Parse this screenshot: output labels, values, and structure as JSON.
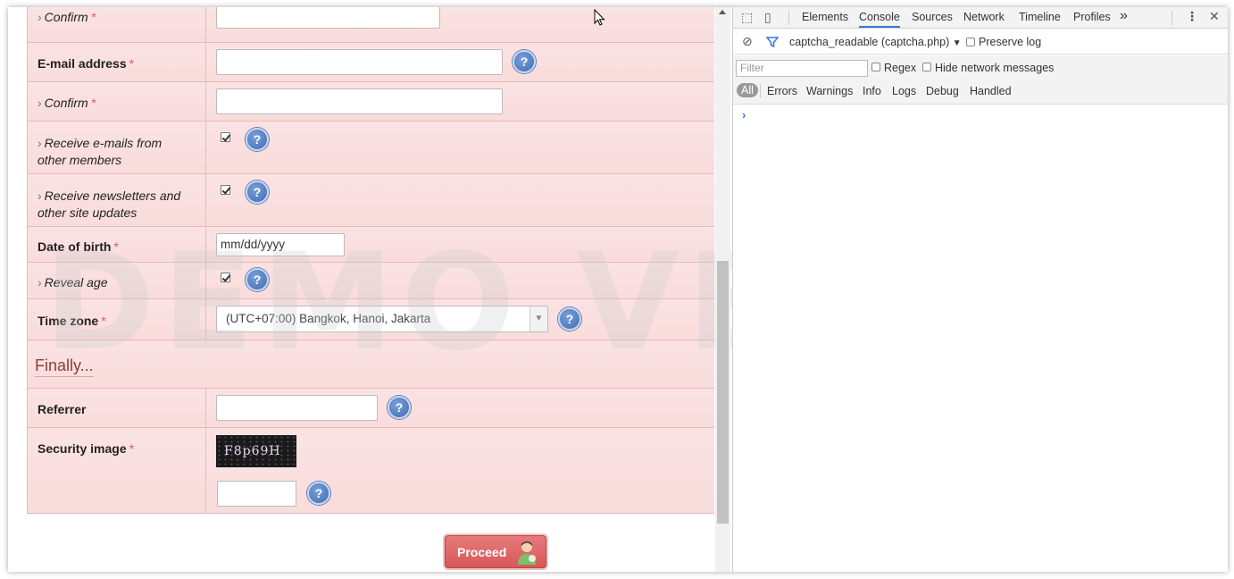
{
  "form": {
    "confirm_label_1": "Confirm",
    "email_label": "E-mail address",
    "confirm_label_2": "Confirm",
    "receive_emails_line1": "Receive e-mails from",
    "receive_emails_line2": "other members",
    "receive_news_line1": "Receive newsletters and",
    "receive_news_line2": "other site updates",
    "dob_label": "Date of birth",
    "dob_placeholder": "mm/dd/yyyy",
    "reveal_age_label": "Reveal age",
    "timezone_label": "Time zone",
    "timezone_value": "(UTC+07:00) Bangkok, Hanoi, Jakarta",
    "section_finally": "Finally...",
    "referrer_label": "Referrer",
    "security_label": "Security image",
    "captcha_text": "F8p69H",
    "required_mark": "*",
    "help_glyph": "?",
    "arrow_glyph": "›",
    "proceed_label": "Proceed"
  },
  "watermark": "DEMO VERSION",
  "devtools": {
    "tabs": [
      "Elements",
      "Console",
      "Sources",
      "Network",
      "Timeline",
      "Profiles"
    ],
    "active_tab": "Console",
    "more_glyph": "»",
    "context": "captcha_readable (captcha.php)",
    "preserve_log": "Preserve log",
    "filter_placeholder": "Filter",
    "regex": "Regex",
    "hide_network": "Hide network messages",
    "levels": [
      "All",
      "Errors",
      "Warnings",
      "Info",
      "Logs",
      "Debug",
      "Handled"
    ],
    "prompt_glyph": "›"
  },
  "colors": {
    "row_bg": "#fbe3e3",
    "required": "#e25a5a",
    "help_blue": "#3f6cb5",
    "proceed": "#d95858",
    "devtools_accent": "#3879d9"
  }
}
